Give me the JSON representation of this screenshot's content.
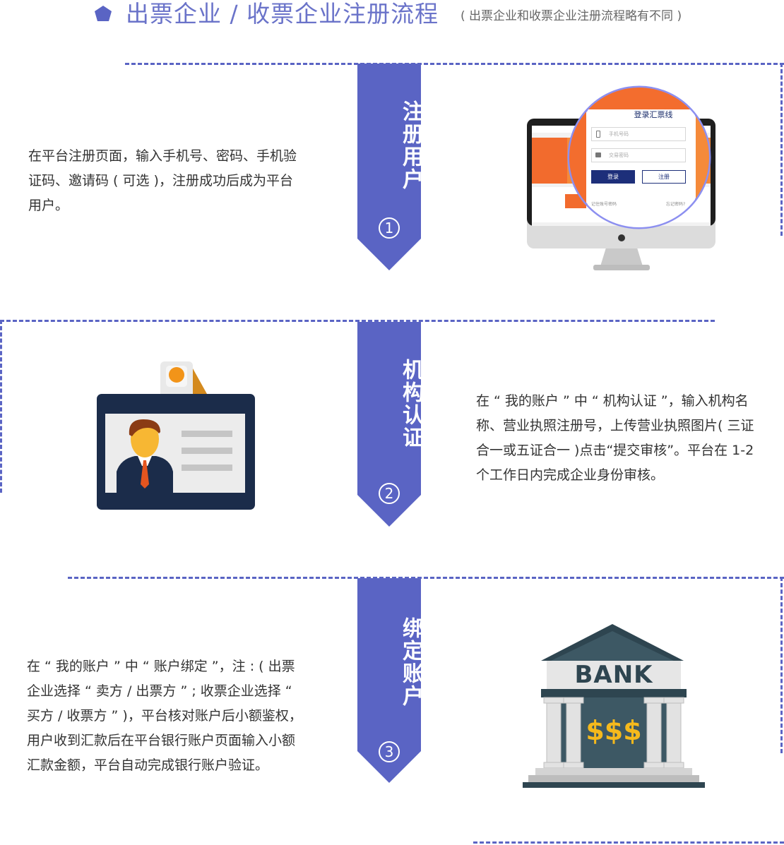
{
  "header": {
    "title": "出票企业 / 收票企业注册流程",
    "subtitle": "( 出票企业和收票企业注册流程略有不同 )",
    "accent_color": "#5a64c4"
  },
  "steps": [
    {
      "title": "注册用户",
      "number": "1",
      "description": "在平台注册页面，输入手机号、密码、手机验证码、邀请码 ( 可选 )，注册成功后成为平台用户。",
      "illustration": "monitor-login",
      "login": {
        "title": "登录汇票线",
        "phone_placeholder": "手机号码",
        "password_placeholder": "交易密码",
        "login_button": "登录",
        "register_button": "注册",
        "remember": "记住账号密码",
        "forgot": "忘记密码?"
      }
    },
    {
      "title": "机构认证",
      "number": "2",
      "description": "在 “ 我的账户 ” 中 “ 机构认证 ”，输入机构名称、营业执照注册号，上传营业执照图片( 三证合一或五证合一 )点击“提交审核”。平台在 1-2 个工作日内完成企业身份审核。",
      "illustration": "id-card"
    },
    {
      "title": "绑定账户",
      "number": "3",
      "description": "在 “ 我的账户 ” 中 “ 账户绑定 ”，注 : ( 出票企业选择 “ 卖方 / 出票方 ” ; 收票企业选择 “ 买方 / 收票方 ” )，平台核对账户后小额鉴权，用户收到汇款后在平台银行账户页面输入小额汇款金额，平台自动完成银行账户验证。",
      "illustration": "bank",
      "bank_label": "BANK",
      "bank_money": "$$$"
    }
  ]
}
